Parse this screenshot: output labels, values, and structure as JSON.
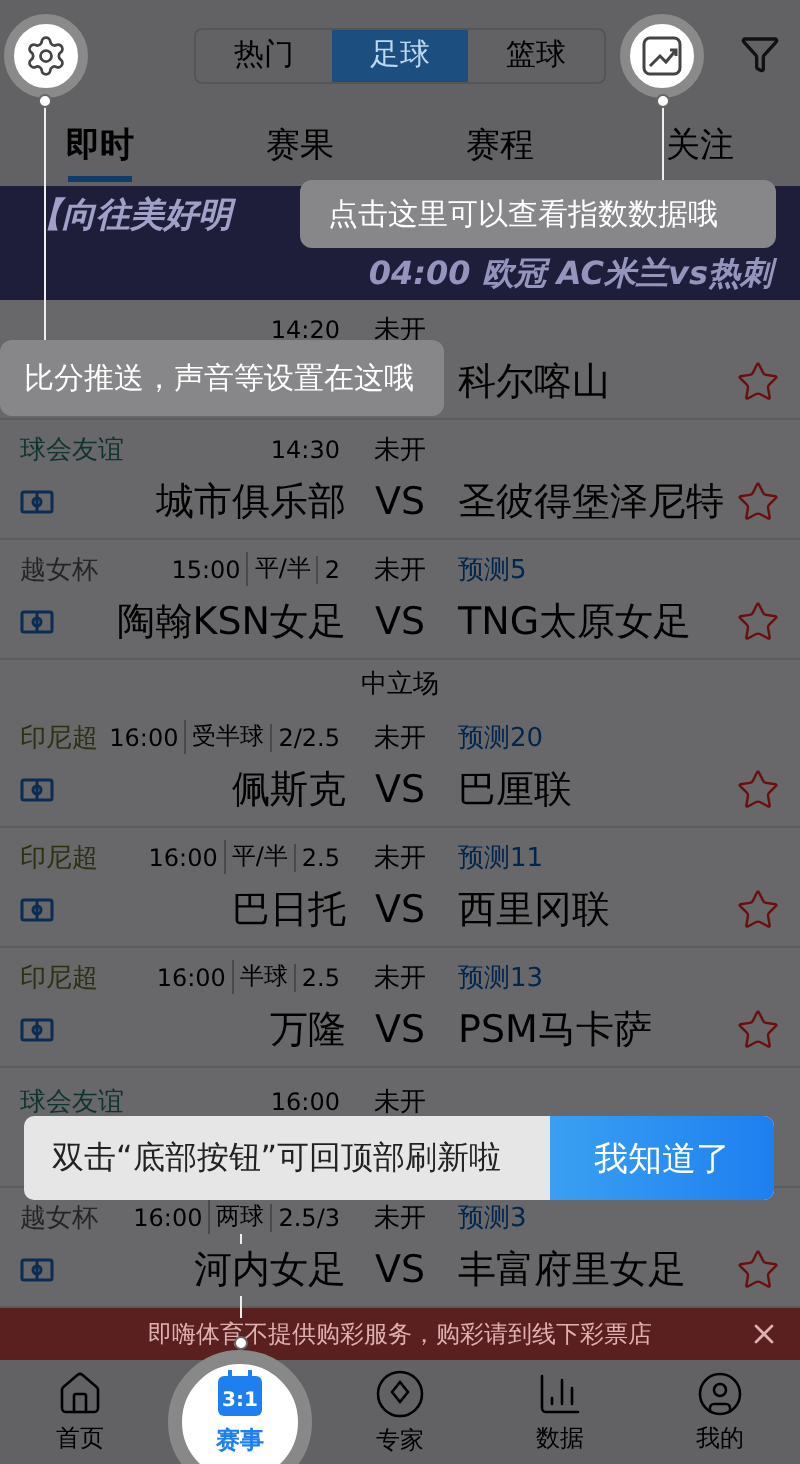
{
  "segments": [
    {
      "label": "热门",
      "selected": false
    },
    {
      "label": "足球",
      "selected": true
    },
    {
      "label": "篮球",
      "selected": false
    }
  ],
  "tabs": [
    {
      "label": "即时",
      "selected": true
    },
    {
      "label": "赛果",
      "selected": false
    },
    {
      "label": "赛程",
      "selected": false
    },
    {
      "label": "关注",
      "selected": false
    }
  ],
  "banner": {
    "title": "【向往美好明",
    "subtitle": "04:00 欧冠 AC米兰vs热刺"
  },
  "matches": [
    {
      "kind": "match",
      "time": "14:20",
      "status": "未开",
      "away": "科尔喀山"
    },
    {
      "kind": "match",
      "league": "球会友谊",
      "color": "#0f3430",
      "time": "14:30",
      "status": "未开",
      "home": "城市俱乐部",
      "vs": "VS",
      "away": "圣彼得堡泽尼特"
    },
    {
      "kind": "match",
      "league": "越女杯",
      "color": "#252525",
      "time": "15:00",
      "handicap": "平/半",
      "line": "2",
      "status": "未开",
      "prediction": "预测5",
      "home": "陶翰KSN女足",
      "vs": "VS",
      "away": "TNG太原女足"
    },
    {
      "kind": "divider",
      "label": "中立场"
    },
    {
      "kind": "match",
      "league": "印尼超",
      "color": "#2a3010",
      "time": "16:00",
      "handicap": "受半球",
      "line": "2/2.5",
      "status": "未开",
      "prediction": "预测20",
      "home": "佩斯克",
      "vs": "VS",
      "away": "巴厘联"
    },
    {
      "kind": "match",
      "league": "印尼超",
      "color": "#2a3010",
      "time": "16:00",
      "handicap": "平/半",
      "line": "2.5",
      "status": "未开",
      "prediction": "预测11",
      "home": "巴日托",
      "vs": "VS",
      "away": "西里冈联"
    },
    {
      "kind": "match",
      "league": "印尼超",
      "color": "#2a3010",
      "time": "16:00",
      "handicap": "半球",
      "line": "2.5",
      "status": "未开",
      "prediction": "预测13",
      "home": "万隆",
      "vs": "VS",
      "away": "PSM马卡萨"
    },
    {
      "kind": "match",
      "league": "球会友谊",
      "color": "#0f3430",
      "time": "16:00",
      "status": "未开"
    },
    {
      "kind": "match",
      "league": "越女杯",
      "color": "#252525",
      "time": "16:00",
      "handicap": "两球",
      "line": "2.5/3",
      "status": "未开",
      "prediction": "预测3",
      "home": "河内女足",
      "vs": "VS",
      "away": "丰富府里女足"
    }
  ],
  "notice": {
    "text": "即嗨体育不提供购彩服务，购彩请到线下彩票店"
  },
  "nav": [
    {
      "label": "首页",
      "selected": false
    },
    {
      "label": "赛事",
      "selected": true,
      "icon_text": "3:1"
    },
    {
      "label": "专家",
      "selected": false
    },
    {
      "label": "数据",
      "selected": false
    },
    {
      "label": "我的",
      "selected": false
    }
  ],
  "tips": [
    {
      "text": "比分推送，声音等设置在这哦"
    },
    {
      "text": "点击这里可以查看指数数据哦"
    },
    {
      "text": "双击“底部按钮”可回顶部刷新啦",
      "button": "我知道了"
    }
  ]
}
